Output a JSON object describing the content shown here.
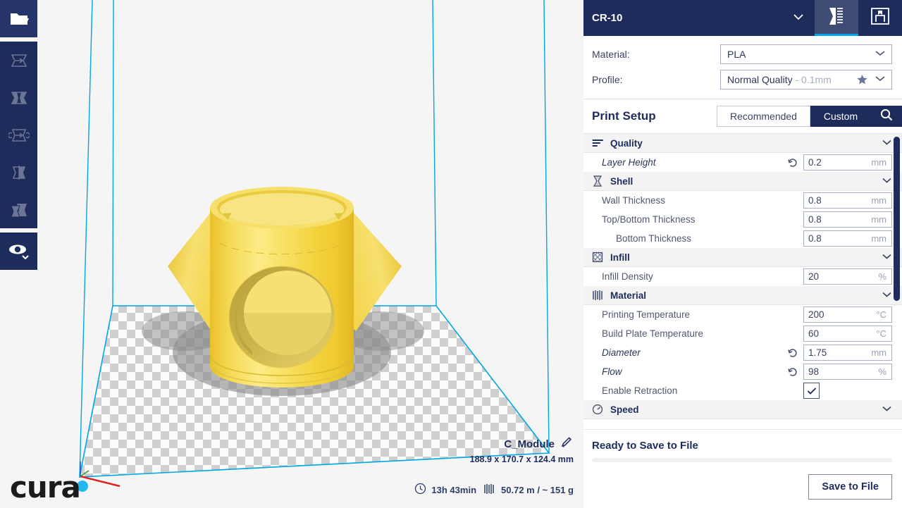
{
  "toolbar": {
    "items": [
      {
        "name": "open-file-button",
        "icon": "folder-icon",
        "active": true
      },
      {
        "name": "move-tool-button",
        "icon": "move-icon",
        "active": false
      },
      {
        "name": "scale-tool-button",
        "icon": "scale-icon",
        "active": false
      },
      {
        "name": "rotate-tool-button",
        "icon": "rotate-icon",
        "active": false
      },
      {
        "name": "mirror-tool-button",
        "icon": "mirror-icon",
        "active": false
      },
      {
        "name": "per-model-settings-button",
        "icon": "per-model-settings-icon",
        "active": false
      },
      {
        "name": "view-mode-button",
        "icon": "eye-icon",
        "active": false
      }
    ]
  },
  "viewport": {
    "logo": "cura",
    "model_name": "C_Module",
    "model_dimensions": "188.9 x 170.7 x 124.4 mm",
    "print_time": "13h 43min",
    "material_usage": "50.72 m / ~ 151 g",
    "colors": {
      "model": "#f2d13c",
      "build_plate_edge": "#00a6e6",
      "background": "#f5f5f5"
    }
  },
  "panel": {
    "printer": {
      "name": "CR-10",
      "dropdown_icon": "chevron-down-icon",
      "tabs": [
        {
          "label": "",
          "icon": "print-setup-icon",
          "name": "tab-print-setup",
          "active": true
        },
        {
          "label": "",
          "icon": "marketplace-icon",
          "name": "tab-marketplace",
          "active": false
        }
      ]
    },
    "meta": {
      "material_label": "Material:",
      "material_value": "PLA",
      "profile_label": "Profile:",
      "profile_value": "Normal Quality",
      "profile_suffix": " - 0.1mm",
      "star_icon": "star-icon",
      "chevron_icon": "chevron-down-icon"
    },
    "setup": {
      "title": "Print Setup",
      "mode_recommended": "Recommended",
      "mode_custom": "Custom",
      "active_mode": "Custom",
      "search_icon": "search-icon"
    },
    "settings": [
      {
        "kind": "category",
        "label": "Quality",
        "icon": "quality-icon",
        "expanded": true
      },
      {
        "kind": "setting",
        "label": "Layer Height",
        "value": "0.2",
        "unit": "mm",
        "italic": true,
        "revert": true,
        "indent": 1
      },
      {
        "kind": "category",
        "label": "Shell",
        "icon": "shell-icon",
        "expanded": true
      },
      {
        "kind": "setting",
        "label": "Wall Thickness",
        "value": "0.8",
        "unit": "mm",
        "italic": false,
        "revert": false,
        "indent": 1
      },
      {
        "kind": "setting",
        "label": "Top/Bottom Thickness",
        "value": "0.8",
        "unit": "mm",
        "italic": false,
        "revert": false,
        "indent": 1
      },
      {
        "kind": "setting",
        "label": "Bottom Thickness",
        "value": "0.8",
        "unit": "mm",
        "italic": false,
        "revert": false,
        "indent": 2
      },
      {
        "kind": "category",
        "label": "Infill",
        "icon": "infill-icon",
        "expanded": true
      },
      {
        "kind": "setting",
        "label": "Infill Density",
        "value": "20",
        "unit": "%",
        "italic": false,
        "revert": false,
        "indent": 1
      },
      {
        "kind": "category",
        "label": "Material",
        "icon": "material-icon",
        "expanded": true
      },
      {
        "kind": "setting",
        "label": "Printing Temperature",
        "value": "200",
        "unit": "°C",
        "italic": false,
        "revert": false,
        "indent": 1
      },
      {
        "kind": "setting",
        "label": "Build Plate Temperature",
        "value": "60",
        "unit": "°C",
        "italic": false,
        "revert": false,
        "indent": 1
      },
      {
        "kind": "setting",
        "label": "Diameter",
        "value": "1.75",
        "unit": "mm",
        "italic": true,
        "revert": true,
        "indent": 1
      },
      {
        "kind": "setting",
        "label": "Flow",
        "value": "98",
        "unit": "%",
        "italic": true,
        "revert": true,
        "indent": 1
      },
      {
        "kind": "checkbox",
        "label": "Enable Retraction",
        "checked": true,
        "italic": false,
        "revert": false,
        "indent": 1
      },
      {
        "kind": "category",
        "label": "Speed",
        "icon": "speed-icon",
        "expanded": true
      }
    ],
    "action": {
      "status": "Ready to Save to File",
      "progress_percent": 0,
      "save_label": "Save to File"
    }
  }
}
